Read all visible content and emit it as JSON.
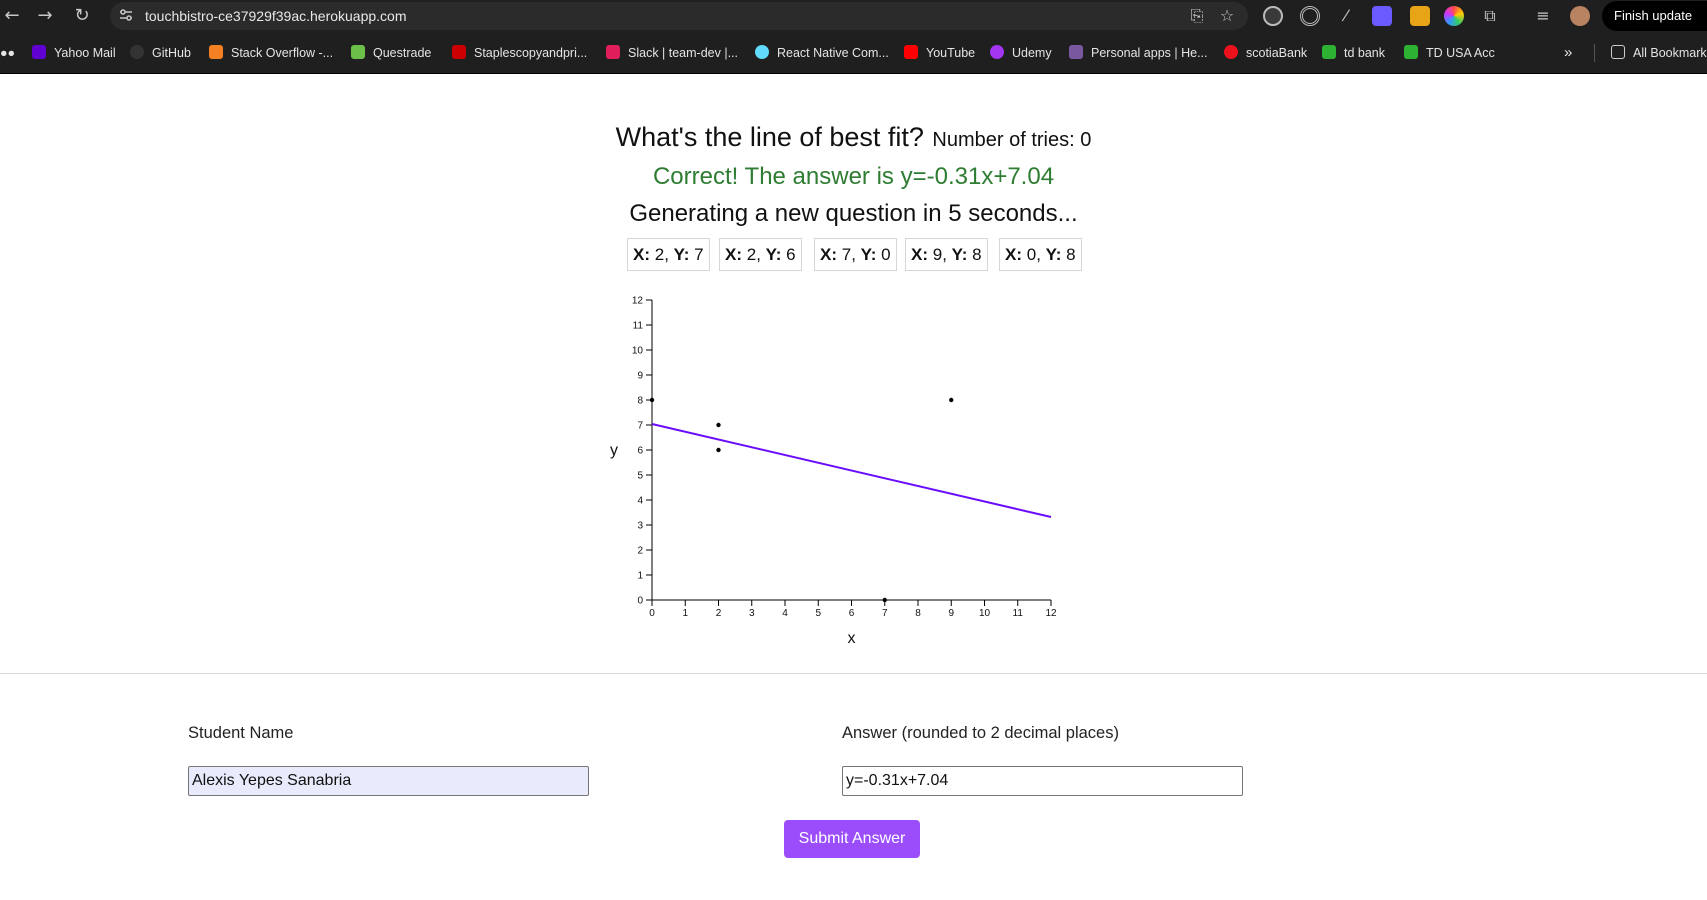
{
  "browser": {
    "url": "touchbistro-ce37929f39ac.herokuapp.com",
    "finish_update_label": "Finish update",
    "bookmarks": [
      {
        "label": "Yahoo Mail",
        "icon": "yahoo-icon",
        "color": "#6001d2"
      },
      {
        "label": "GitHub",
        "icon": "github-icon",
        "color": "#333333"
      },
      {
        "label": "Stack Overflow -...",
        "icon": "stackoverflow-icon",
        "color": "#f48024"
      },
      {
        "label": "Questrade",
        "icon": "questrade-icon",
        "color": "#6cc04a"
      },
      {
        "label": "Staplescopyandpri...",
        "icon": "staples-icon",
        "color": "#cc0000"
      },
      {
        "label": "Slack | team-dev |...",
        "icon": "slack-icon",
        "color": "#e01e5a"
      },
      {
        "label": "React Native Com...",
        "icon": "react-icon",
        "color": "#61dafb"
      },
      {
        "label": "YouTube",
        "icon": "youtube-icon",
        "color": "#ff0000"
      },
      {
        "label": "Udemy",
        "icon": "udemy-icon",
        "color": "#a435f0"
      },
      {
        "label": "Personal apps | He...",
        "icon": "heroku-icon",
        "color": "#79589f"
      },
      {
        "label": "scotiaBank",
        "icon": "scotiabank-icon",
        "color": "#ec111a"
      },
      {
        "label": "td bank",
        "icon": "td-icon",
        "color": "#2db233"
      },
      {
        "label": "TD USA Acc",
        "icon": "td-icon",
        "color": "#2db233"
      }
    ],
    "all_bookmarks_label": "All Bookmarks"
  },
  "page": {
    "title": "What's the line of best fit?",
    "tries_label": "Number of tries: 0",
    "result_message": "Correct! The answer is y=-0.31x+7.04",
    "generating_message": "Generating a new question in 5 seconds...",
    "points": [
      {
        "x": 2,
        "y": 7
      },
      {
        "x": 2,
        "y": 6
      },
      {
        "x": 7,
        "y": 0
      },
      {
        "x": 9,
        "y": 8
      },
      {
        "x": 0,
        "y": 8
      }
    ],
    "x_prefix": "X:",
    "y_prefix": "Y:"
  },
  "chart_data": {
    "type": "scatter",
    "title": "",
    "xlabel": "x",
    "ylabel": "y",
    "xlim": [
      0,
      12
    ],
    "ylim": [
      0,
      12
    ],
    "x_ticks": [
      0,
      1,
      2,
      3,
      4,
      5,
      6,
      7,
      8,
      9,
      10,
      11,
      12
    ],
    "y_ticks": [
      0,
      1,
      2,
      3,
      4,
      5,
      6,
      7,
      8,
      9,
      10,
      11,
      12
    ],
    "points": [
      {
        "x": 2,
        "y": 7
      },
      {
        "x": 2,
        "y": 6
      },
      {
        "x": 7,
        "y": 0
      },
      {
        "x": 9,
        "y": 8
      },
      {
        "x": 0,
        "y": 8
      }
    ],
    "best_fit_line": {
      "slope": -0.31,
      "intercept": 7.04,
      "x_range": [
        0,
        12
      ],
      "color": "#6a0dfc"
    },
    "point_color": "#000000"
  },
  "form": {
    "student_name_label": "Student Name",
    "student_name_value": "Alexis Yepes Sanabria",
    "answer_label": "Answer (rounded to 2 decimal places)",
    "answer_value": "y=-0.31x+7.04",
    "submit_label": "Submit Answer"
  }
}
